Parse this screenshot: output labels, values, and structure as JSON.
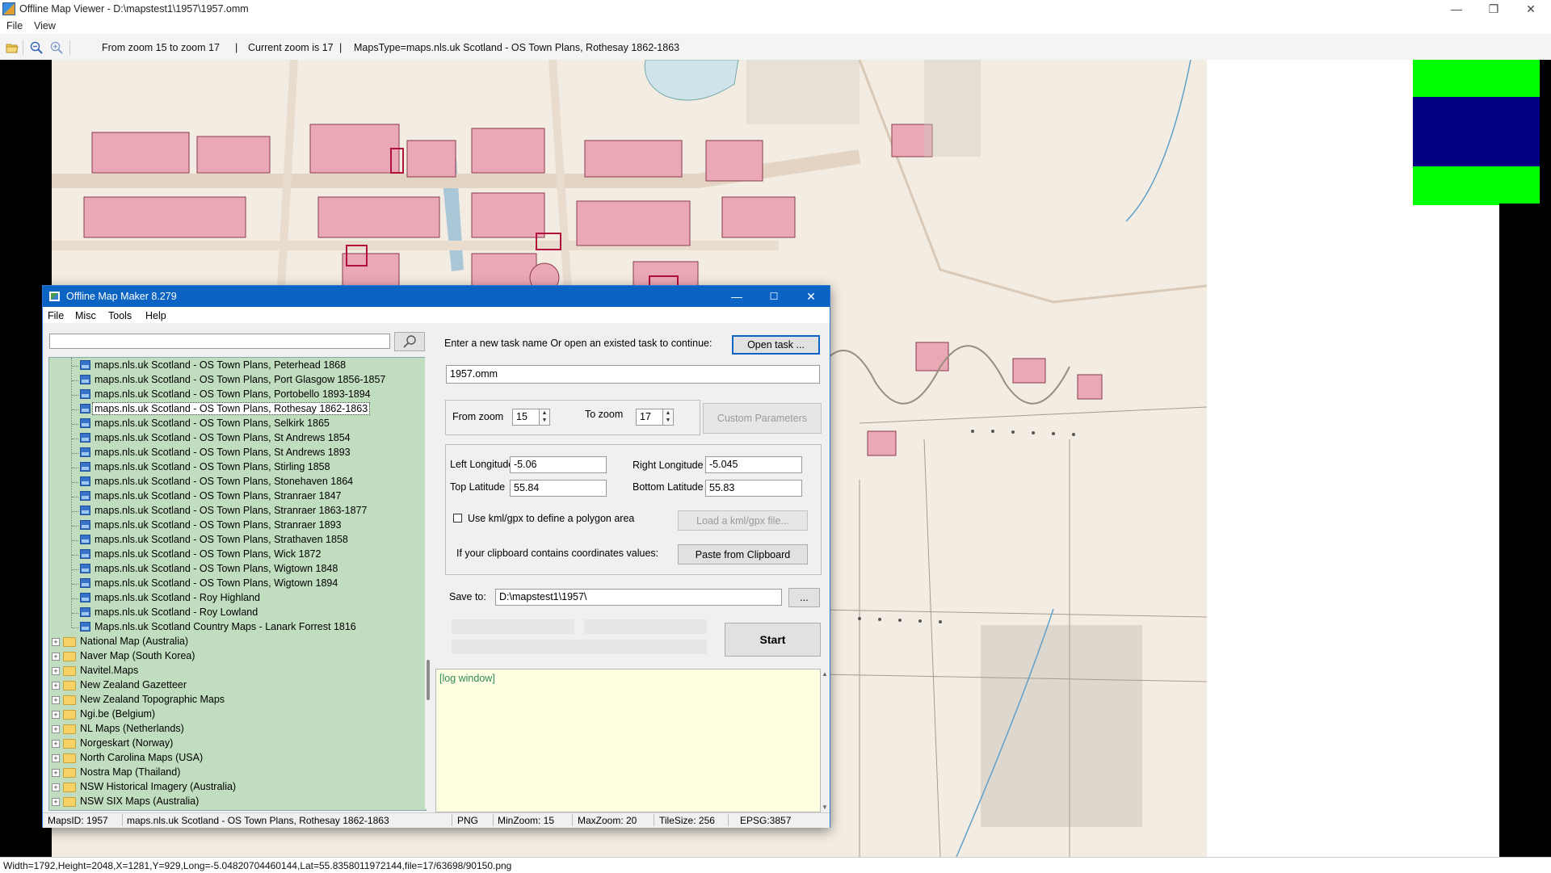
{
  "viewer": {
    "title": "Offline Map Viewer - D:\\mapstest1\\1957\\1957.omm",
    "window_controls": {
      "minimize": "—",
      "restore": "❐",
      "close": "✕"
    },
    "menu": [
      "File",
      "View"
    ],
    "toolbar": {
      "zoom_range": "From zoom 15 to zoom 17",
      "current_zoom": "Current zoom is 17",
      "maps_type": "MapsType=maps.nls.uk Scotland - OS Town Plans, Rothesay 1862-1863"
    },
    "status": "Width=1792,Height=2048,X=1281,Y=929,Long=-5.04820704460144,Lat=55.8358011972144,file=17/63698/90150.png"
  },
  "dialog": {
    "title": "Offline Map Maker 8.279",
    "window_controls": {
      "minimize": "—",
      "maximize": "☐",
      "close": "✕"
    },
    "menu": [
      "File",
      "Misc",
      "Tools",
      "Help"
    ],
    "search": {
      "value": "",
      "placeholder": ""
    },
    "tree": {
      "maps": [
        "maps.nls.uk Scotland - OS Town Plans, Peterhead 1868",
        "maps.nls.uk Scotland - OS Town Plans, Port Glasgow 1856-1857",
        "maps.nls.uk Scotland - OS Town Plans, Portobello 1893-1894",
        "maps.nls.uk Scotland - OS Town Plans, Rothesay 1862-1863",
        "maps.nls.uk Scotland - OS Town Plans, Selkirk 1865",
        "maps.nls.uk Scotland - OS Town Plans, St Andrews 1854",
        "maps.nls.uk Scotland - OS Town Plans, St Andrews 1893",
        "maps.nls.uk Scotland - OS Town Plans, Stirling 1858",
        "maps.nls.uk Scotland - OS Town Plans, Stonehaven 1864",
        "maps.nls.uk Scotland - OS Town Plans, Stranraer 1847",
        "maps.nls.uk Scotland - OS Town Plans, Stranraer 1863-1877",
        "maps.nls.uk Scotland - OS Town Plans, Stranraer 1893",
        "maps.nls.uk Scotland - OS Town Plans, Strathaven 1858",
        "maps.nls.uk Scotland - OS Town Plans, Wick 1872",
        "maps.nls.uk Scotland - OS Town Plans, Wigtown 1848",
        "maps.nls.uk Scotland - OS Town Plans, Wigtown 1894",
        "maps.nls.uk Scotland - Roy Highland",
        "maps.nls.uk Scotland - Roy Lowland",
        "Maps.nls.uk Scotland Country Maps - Lanark Forrest 1816"
      ],
      "selected_index": 3,
      "folders": [
        "National Map (Australia)",
        "Naver Map (South Korea)",
        "Navitel.Maps",
        "New Zealand Gazetteer",
        "New Zealand Topographic Maps",
        "Ngi.be (Belgium)",
        "NL Maps (Netherlands)",
        "Norgeskart (Norway)",
        "North Carolina Maps (USA)",
        "Nostra Map (Thailand)",
        "NSW Historical Imagery (Australia)",
        "NSW SIX Maps (Australia)"
      ]
    },
    "task": {
      "prompt": "Enter a new task name Or open an existed task to continue:",
      "open_button": "Open task ...",
      "task_name": "1957.omm"
    },
    "zoom": {
      "from_label": "From zoom",
      "from_value": "15",
      "to_label": "To zoom",
      "to_value": "17",
      "custom_button": "Custom Parameters"
    },
    "coords": {
      "left_lon_label": "Left Longitude",
      "left_lon": "-5.06",
      "right_lon_label": "Right Longitude",
      "right_lon": "-5.045",
      "top_lat_label": "Top Latitude",
      "top_lat": "55.84",
      "bottom_lat_label": "Bottom Latitude",
      "bottom_lat": "55.83",
      "kml_checkbox_label": "Use kml/gpx to define a polygon area",
      "kml_checked": false,
      "load_kml_button": "Load a kml/gpx file...",
      "clipboard_label": "If your clipboard contains coordinates values:",
      "paste_button": "Paste from Clipboard"
    },
    "save": {
      "label": "Save to:",
      "path": "D:\\mapstest1\\1957\\",
      "browse_button": "...",
      "start_button": "Start"
    },
    "log": {
      "text": "[log window]"
    },
    "status": {
      "maps_id": "MapsID: 1957",
      "map_name": "maps.nls.uk Scotland - OS Town Plans, Rothesay 1862-1863",
      "format": "PNG",
      "min_zoom": "MinZoom: 15",
      "max_zoom": "MaxZoom: 20",
      "tile_size": "TileSize: 256",
      "epsg": "EPSG:3857"
    }
  },
  "colors": {
    "tree_bg": "#c0ddbf",
    "log_bg": "#ffffe1",
    "dialog_title_bg": "#0b63c4",
    "map_paper": "#f3ece2",
    "map_building": "#eaa7b5",
    "overview_green": "#00ff00",
    "overview_navy": "#000080"
  }
}
